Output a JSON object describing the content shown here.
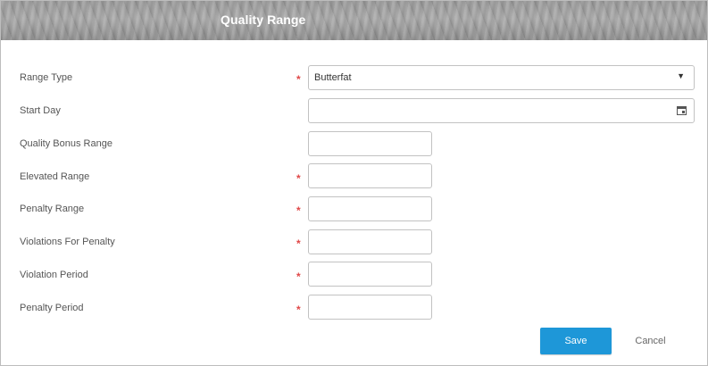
{
  "dialog": {
    "title": "Quality Range"
  },
  "form": {
    "range_type": {
      "label": "Range Type",
      "required_mark": "*",
      "value": "Butterfat",
      "caret": "▼"
    },
    "start_day": {
      "label": "Start Day",
      "value": ""
    },
    "quality_bonus_range": {
      "label": "Quality Bonus Range",
      "value": ""
    },
    "elevated_range": {
      "label": "Elevated Range",
      "required_mark": "*",
      "value": ""
    },
    "penalty_range": {
      "label": "Penalty Range",
      "required_mark": "*",
      "value": ""
    },
    "violations_for_penalty": {
      "label": "Violations For Penalty",
      "required_mark": "*",
      "value": ""
    },
    "violation_period": {
      "label": "Violation Period",
      "required_mark": "*",
      "value": ""
    },
    "penalty_period": {
      "label": "Penalty Period",
      "required_mark": "*",
      "value": ""
    }
  },
  "actions": {
    "save_label": "Save",
    "cancel_label": "Cancel"
  },
  "colors": {
    "primary": "#1e97d8",
    "required": "#e04848"
  },
  "icons": {
    "calendar": "calendar-icon",
    "dropdown": "chevron-down-icon"
  }
}
